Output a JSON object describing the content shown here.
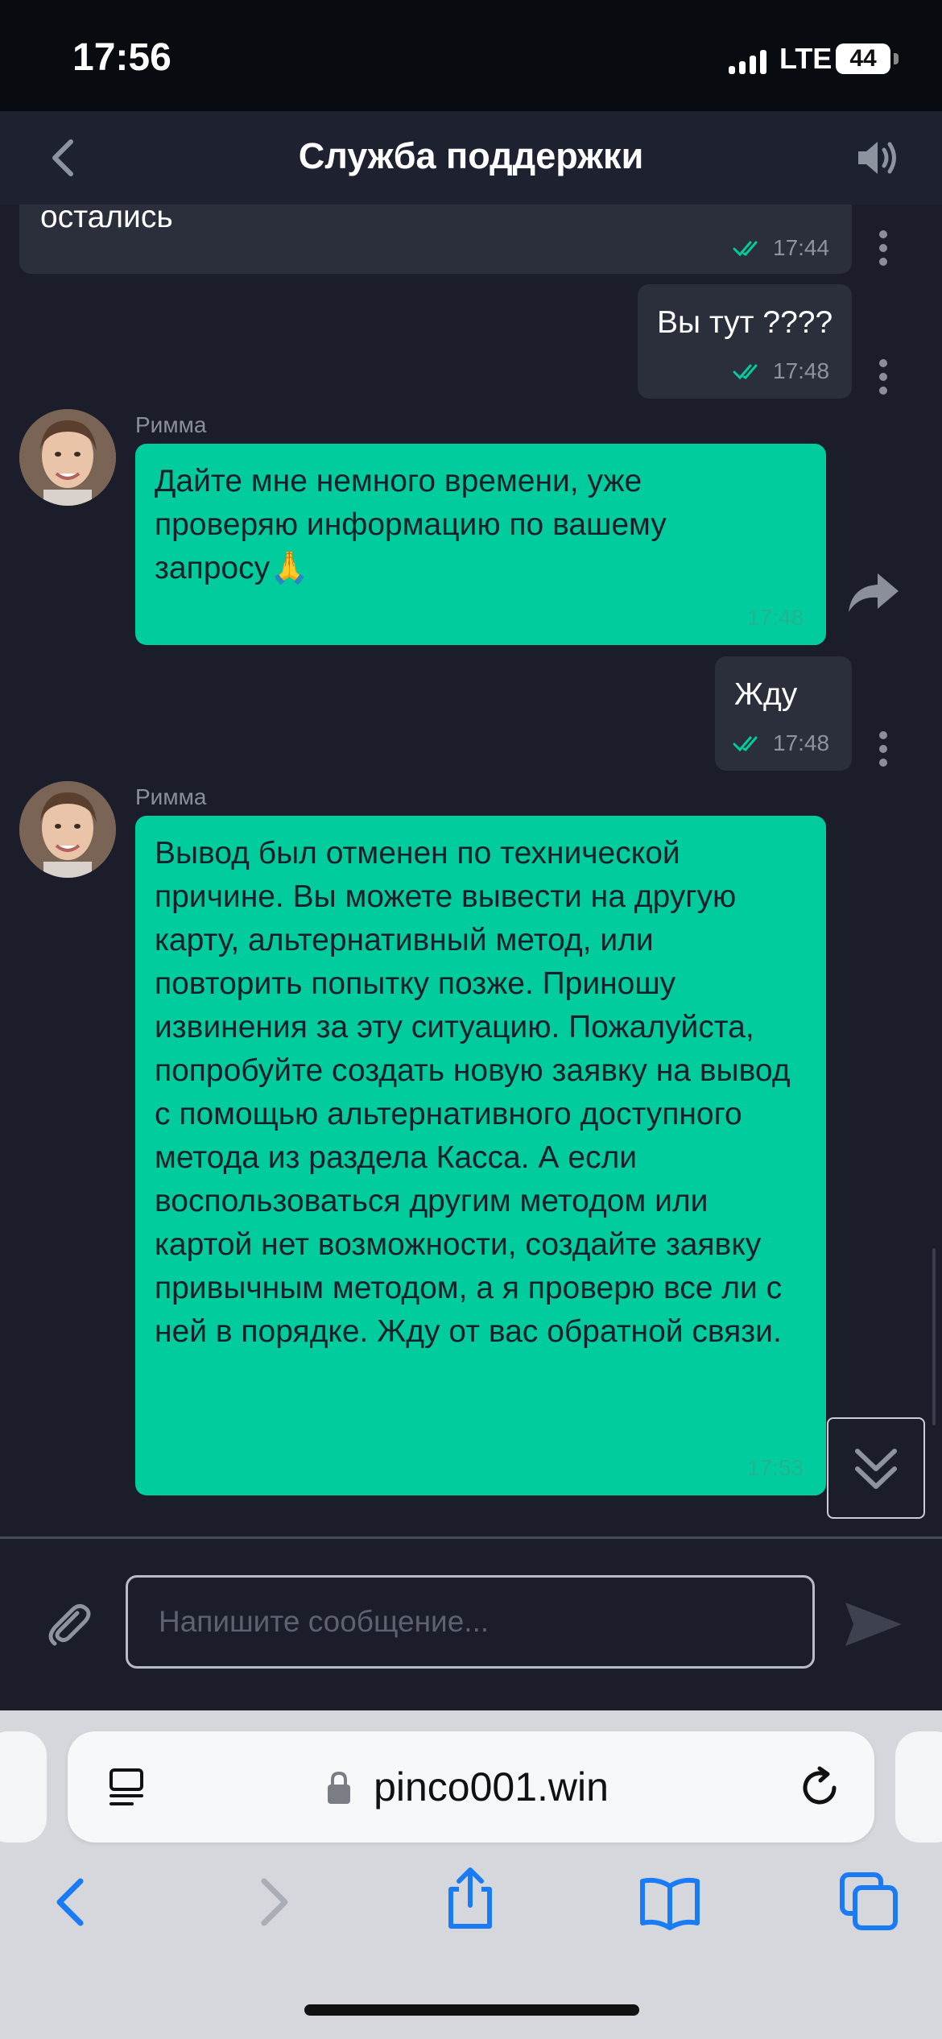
{
  "status": {
    "time": "17:56",
    "network": "LTE",
    "battery": "44"
  },
  "header": {
    "title": "Служба поддержки"
  },
  "messages": [
    {
      "type": "out",
      "text": "остались",
      "time": "17:44"
    },
    {
      "type": "out",
      "text": "Вы тут ????",
      "time": "17:48"
    },
    {
      "type": "in",
      "sender": "Римма",
      "text": "Дайте мне немного времени, уже проверяю информацию по вашему запросу🙏",
      "time": "17:48"
    },
    {
      "type": "out",
      "text": "Жду",
      "time": "17:48"
    },
    {
      "type": "in",
      "sender": "Римма",
      "text": "Вывод был отменен по технической причине. Вы можете вывести на другую карту, альтернативный метод, или повторить попытку позже. Приношу извинения за эту ситуацию. Пожалуйста, попробуйте создать новую заявку на вывод с помощью альтернативного доступного метода из раздела Касса. А если воспользоваться другим методом или картой нет возможности, создайте заявку привычным методом, а я проверю все ли с ней в порядке. Жду от вас обратной связи.",
      "time": "17:53"
    }
  ],
  "input": {
    "placeholder": "Напишите сообщение...",
    "value": ""
  },
  "browser": {
    "url": "pinco001.win"
  },
  "colors": {
    "accent": "#00cc9e",
    "background": "#1b1e2a",
    "outgoing_bubble": "#2b2f3c",
    "browser_link": "#1a7cf5"
  }
}
